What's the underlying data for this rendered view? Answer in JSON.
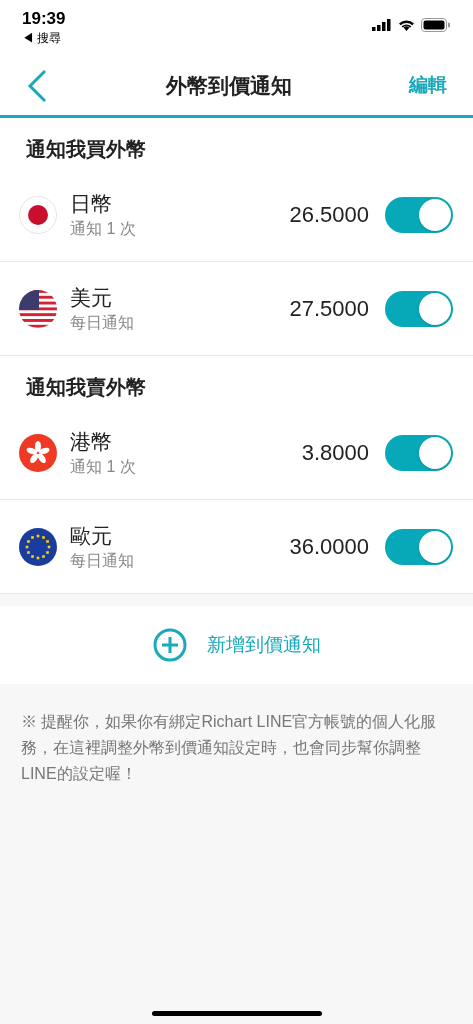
{
  "status_bar": {
    "time": "19:39",
    "back_app": "◀ 搜尋"
  },
  "nav": {
    "title": "外幣到價通知",
    "action": "編輯"
  },
  "sections": [
    {
      "title": "通知我買外幣",
      "items": [
        {
          "kind": "jp",
          "name": "日幣",
          "frequency": "通知 1 次",
          "price": "26.5000",
          "on": true
        },
        {
          "kind": "us",
          "name": "美元",
          "frequency": "每日通知",
          "price": "27.5000",
          "on": true
        }
      ]
    },
    {
      "title": "通知我賣外幣",
      "items": [
        {
          "kind": "hk",
          "name": "港幣",
          "frequency": "通知 1 次",
          "price": "3.8000",
          "on": true
        },
        {
          "kind": "eu",
          "name": "歐元",
          "frequency": "每日通知",
          "price": "36.0000",
          "on": true
        }
      ]
    }
  ],
  "add_button": "新增到價通知",
  "note": "※ 提醒你，如果你有綁定Richart LINE官方帳號的個人化服務，在這裡調整外幣到價通知設定時，也會同步幫你調整LINE的設定喔！"
}
